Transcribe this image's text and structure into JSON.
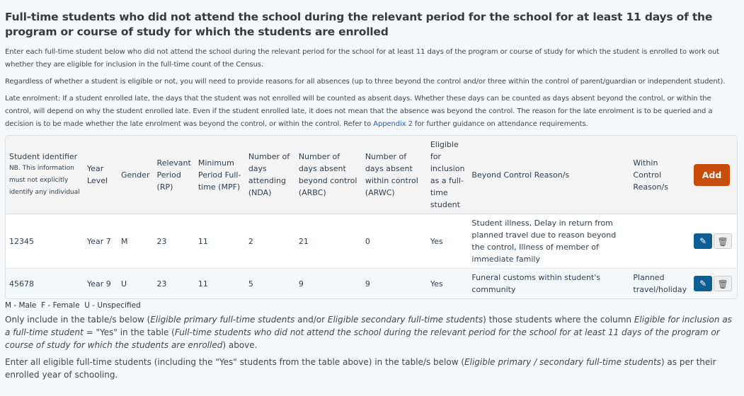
{
  "title": "Full-time students who did not attend the school during the relevant period for the school for at least 11 days of the program or course of study for which the students are enrolled",
  "intro": "Enter each full-time student below who did not attend the school during the relevant period for the school for at least 11 days of the program or course of study for which the student is enrolled to work out whether they are eligible for inclusion in the full-time count of the Census.",
  "reasons_note": "Regardless of whether a student is eligible or not, you will need to provide reasons for all absences (up to three beyond the control and/or three within the control of parent/guardian or independent student).",
  "late_enrolment": {
    "text": "Late enrolment: If a student enrolled late, the days that the student was not enrolled will be counted as absent days. Whether these days can be counted as days absent beyond the control, or within the control, will depend on why the student enrolled late. Even if the student enrolled late, it does not mean that the absence was beyond the control. The reason for the late enrolment is to be queried and a decision is to be made whether the late enrolment was beyond the control, or within the control. Refer to ",
    "link": "Appendix 2",
    "after": " for further guidance on attendance requirements."
  },
  "table": {
    "headers": {
      "student_id": "Student identifier",
      "student_id_note": "NB. This information must not explicitly identify any individual",
      "year": "Year Level",
      "gender": "Gender",
      "rp": "Relevant Period (RP)",
      "mpf": "Minimum Period Full-time (MPF)",
      "nda": "Number of days attending (NDA)",
      "arbc": "Number of days absent beyond control (ARBC)",
      "arwc": "Number of days absent within control (ARWC)",
      "eligible": "Eligible for inclusion as a full-time student",
      "beyond": "Beyond Control Reason/s",
      "within": "Within Control Reason/s",
      "add": "Add"
    },
    "rows": [
      {
        "id": "12345",
        "year": "Year 7",
        "gender": "M",
        "rp": "23",
        "mpf": "11",
        "nda": "2",
        "arbc": "21",
        "arwc": "0",
        "eligible": "Yes",
        "beyond": "Student illness, Delay in return from planned travel due to reason beyond the control, Illness of member of immediate family",
        "within": ""
      },
      {
        "id": "45678",
        "year": "Year 9",
        "gender": "U",
        "rp": "23",
        "mpf": "11",
        "nda": "5",
        "arbc": "9",
        "arwc": "9",
        "eligible": "Yes",
        "beyond": "Funeral customs within student's community",
        "within": "Planned travel/holiday"
      }
    ],
    "icons": {
      "edit": "edit-icon",
      "delete": "trash-icon"
    }
  },
  "legend": "M - Male  F - Female  U - Unspecified",
  "only_include": {
    "a": "Only include in the table/s below (",
    "b": "Eligible primary full-time students",
    "c": " and/or ",
    "d": "Eligible secondary full-time students",
    "e": ") those students where the column ",
    "f": "Eligible for inclusion as a full-time student",
    "g": " = \"Yes\" in the table (",
    "h": "Full-time students who did not attend the school during the relevant period for the school for at least 11 days of the program or course of study for which the students are enrolled",
    "i": ") above."
  },
  "enter_all": {
    "a": "Enter all eligible full-time students (including the \"Yes\" students from the table above) in the table/s below (",
    "b": "Eligible primary / secondary full-time students",
    "c": ") as per their enrolled year of schooling."
  },
  "colors": {
    "add": "#c84d0a",
    "edit": "#0d5e93",
    "link": "#1a5fd0"
  }
}
